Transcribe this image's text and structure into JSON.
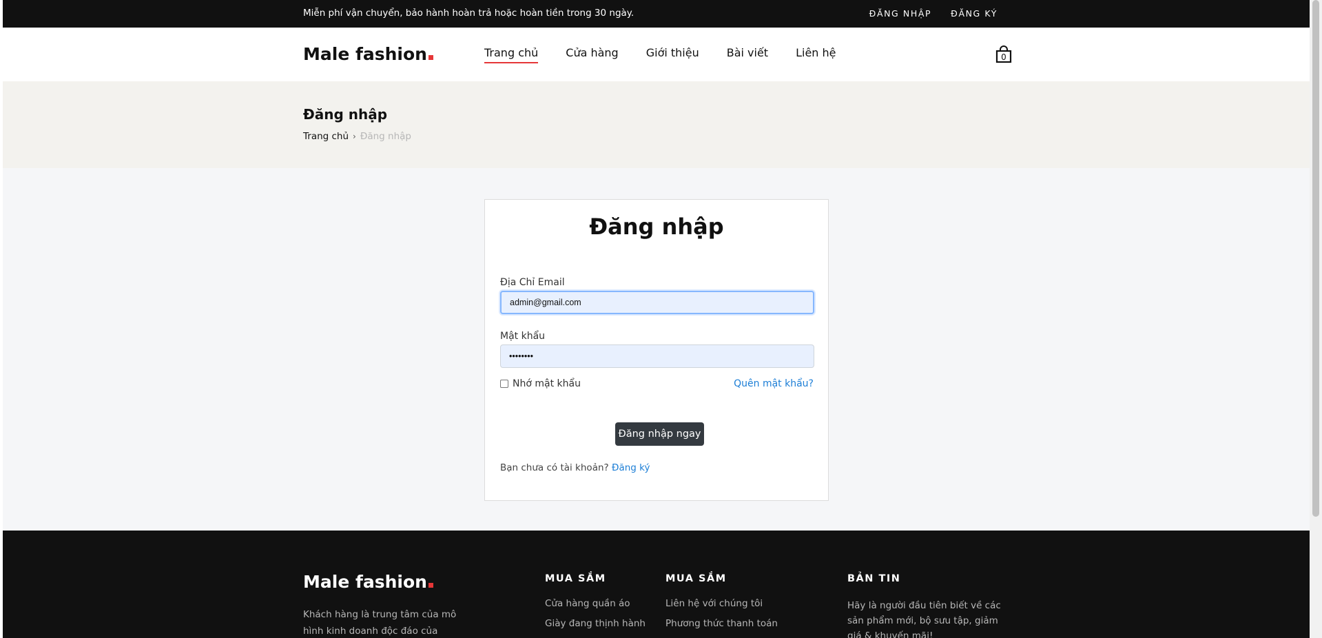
{
  "topbar": {
    "promo": "Miễn phí vận chuyển, bảo hành hoàn trả hoặc hoàn tiền trong 30 ngày.",
    "login": "ĐĂNG NHẬP",
    "register": "ĐĂNG KÝ"
  },
  "brand": {
    "name": "Male fashion",
    "accent": "#e53637"
  },
  "nav": {
    "items": [
      {
        "label": "Trang chủ"
      },
      {
        "label": "Cửa hàng"
      },
      {
        "label": "Giới thiệu"
      },
      {
        "label": "Bài viết"
      },
      {
        "label": "Liên hệ"
      }
    ],
    "active": "Trang chủ"
  },
  "cart": {
    "icon": "shopping-bag-icon",
    "count": "0"
  },
  "breadcrumb": {
    "title": "Đăng nhập",
    "home": "Trang chủ",
    "separator": "›",
    "current": "Đăng nhập"
  },
  "login_form": {
    "title": "Đăng nhập",
    "email_label": "Địa Chỉ Email",
    "email_value": "admin@gmail.com",
    "password_label": "Mật khẩu",
    "password_value": "••••••••",
    "remember_label": "Nhớ mật khẩu",
    "forgot_label": "Quên mật khẩu?",
    "submit_label": "Đăng nhập ngay",
    "no_account_text": "Bạn chưa có tài khoản?",
    "signup_link": "Đăng ký"
  },
  "footer": {
    "about": "Khách hàng là trung tâm của mô hình kinh doanh độc đáo của chúng tôi, bao",
    "col1": {
      "title": "MUA SẮM",
      "links": [
        "Cửa hàng quần áo",
        "Giày đang thịnh hành"
      ]
    },
    "col2": {
      "title": "MUA SẮM",
      "links": [
        "Liên hệ với chúng tôi",
        "Phương thức thanh toán"
      ]
    },
    "newsletter": {
      "title": "BẢN TIN",
      "text": "Hãy là người đầu tiên biết về các sản phẩm mới, bộ sưu tập, giảm giá & khuyến mãi!"
    }
  }
}
